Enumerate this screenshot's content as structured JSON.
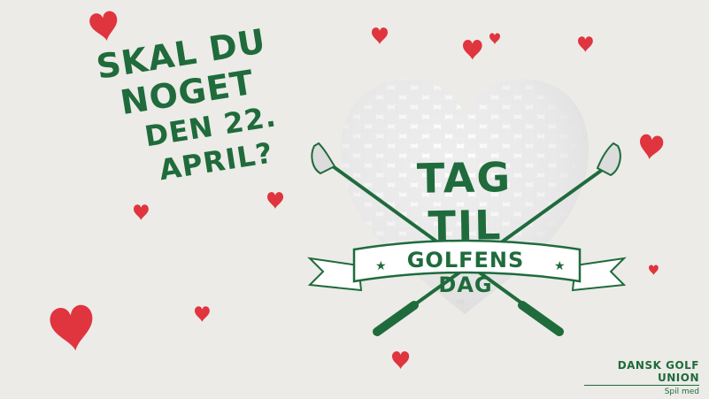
{
  "headline": {
    "line1": "SKAL DU NOGET",
    "line2": "DEN 22. APRIL?"
  },
  "emblem": {
    "title": "TAG TIL",
    "banner": "GOLFENS DAG",
    "heart_icon": "golf-ball-heart-icon",
    "clubs_icon": "crossed-golf-clubs-icon"
  },
  "logo": {
    "brand": "DANSK GOLF UNION",
    "tagline": "Spil med"
  },
  "colors": {
    "background": "#ecebe7",
    "brand_green": "#1f6b3c",
    "heart_red": "#e0343f"
  }
}
